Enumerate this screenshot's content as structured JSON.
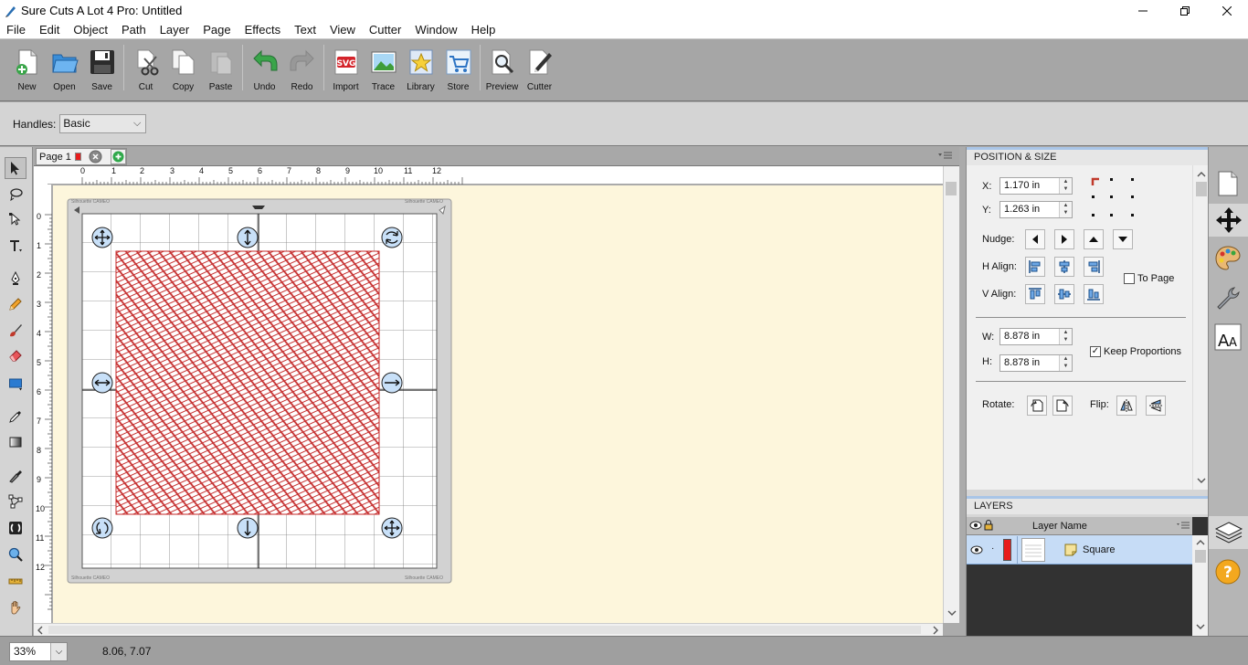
{
  "window": {
    "title": "Sure Cuts A Lot 4 Pro: Untitled"
  },
  "menu": [
    "File",
    "Edit",
    "Object",
    "Path",
    "Layer",
    "Page",
    "Effects",
    "Text",
    "View",
    "Cutter",
    "Window",
    "Help"
  ],
  "toolbar": {
    "new": "New",
    "open": "Open",
    "save": "Save",
    "cut": "Cut",
    "copy": "Copy",
    "paste": "Paste",
    "undo": "Undo",
    "redo": "Redo",
    "import": "Import",
    "trace": "Trace",
    "library": "Library",
    "store": "Store",
    "preview": "Preview",
    "cutter": "Cutter"
  },
  "handles": {
    "label": "Handles:",
    "value": "Basic"
  },
  "page_tab": {
    "label": "Page 1"
  },
  "rulers": {
    "h": [
      "0",
      "1",
      "2",
      "3",
      "4",
      "5",
      "6",
      "7",
      "8",
      "9",
      "10",
      "11",
      "12"
    ],
    "v": [
      "0",
      "1",
      "2",
      "3",
      "4",
      "5",
      "6",
      "7",
      "8",
      "9",
      "10",
      "11",
      "12"
    ]
  },
  "mat": {
    "brand_tl": "Silhouette CAMEO",
    "brand_tr": "Silhouette CAMEO",
    "brand_bl": "Silhouette CAMEO",
    "brand_br": "Silhouette CAMEO"
  },
  "position_size": {
    "header": "POSITION & SIZE",
    "x_label": "X:",
    "x_value": "1.170 in",
    "y_label": "Y:",
    "y_value": "1.263 in",
    "nudge_label": "Nudge:",
    "halign_label": "H Align:",
    "valign_label": "V Align:",
    "to_page_label": "To Page",
    "w_label": "W:",
    "w_value": "8.878 in",
    "h_label": "H:",
    "h_value": "8.878 in",
    "keep_proportions_label": "Keep Proportions",
    "keep_proportions_checked": true,
    "to_page_checked": false,
    "rotate_label": "Rotate:",
    "flip_label": "Flip:"
  },
  "layers": {
    "header": "LAYERS",
    "column_name": "Layer Name",
    "rows": [
      {
        "name": "Square",
        "color": "#e81c1c"
      }
    ]
  },
  "status": {
    "zoom": "33%",
    "coords": "8.06, 7.07"
  },
  "colors": {
    "accent": "#a9c5e7",
    "layer_color": "#e81c1c",
    "pattern": "#c42a2a"
  }
}
